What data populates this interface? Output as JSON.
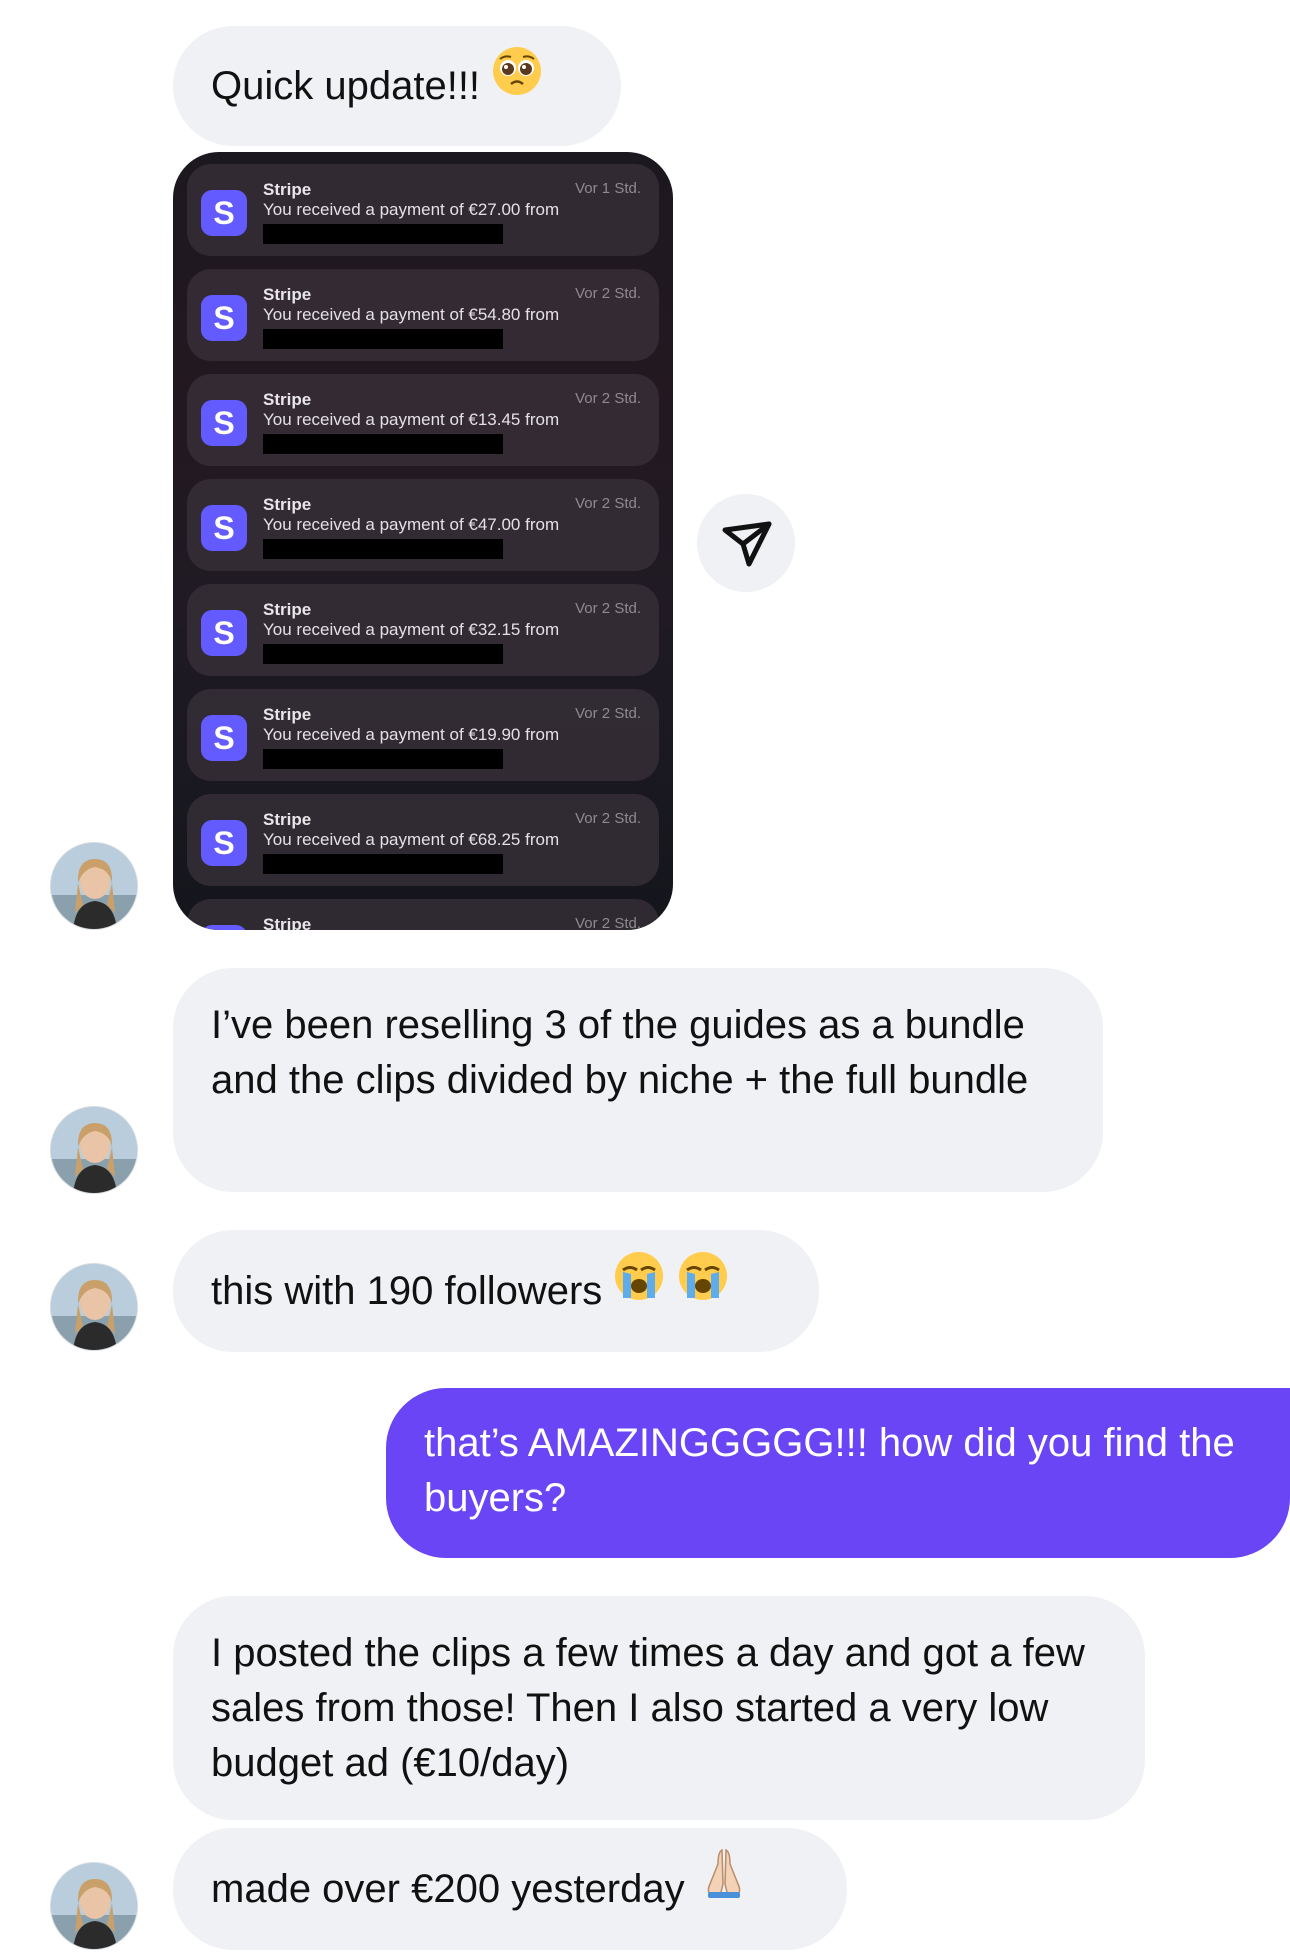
{
  "messages": {
    "m1": "Quick update!!!",
    "m2": "I’ve been reselling 3 of the guides as a bundle and the clips divided by niche + the full bundle",
    "m3": "this with 190 followers",
    "m4": "that’s AMAZINGGGGG!!! how did you find the buyers?",
    "m5": "I posted the clips a few times a day and got a few sales from those! Then I also started a very low budget ad (€10/day)",
    "m6": "made over €200 yesterday"
  },
  "screenshot": {
    "notifications": [
      {
        "app": "Stripe",
        "time": "Vor 1 Std.",
        "body": "You received a payment of €27.00 from"
      },
      {
        "app": "Stripe",
        "time": "Vor 2 Std.",
        "body": "You received a payment of €54.80 from"
      },
      {
        "app": "Stripe",
        "time": "Vor 2 Std.",
        "body": "You received a payment of €13.45 from"
      },
      {
        "app": "Stripe",
        "time": "Vor 2 Std.",
        "body": "You received a payment of €47.00 from"
      },
      {
        "app": "Stripe",
        "time": "Vor 2 Std.",
        "body": "You received a payment of €32.15 from"
      },
      {
        "app": "Stripe",
        "time": "Vor 2 Std.",
        "body": "You received a payment of €19.90 from"
      },
      {
        "app": "Stripe",
        "time": "Vor 2 Std.",
        "body": "You received a payment of €68.25 from"
      },
      {
        "app": "Stripe",
        "time": "Vor 2 Std.",
        "body": ""
      }
    ],
    "app_icon_letter": "S"
  },
  "colors": {
    "incoming_bubble": "#eff1f4",
    "outgoing_bubble": "#6a45f5",
    "stripe_brand": "#635bff"
  },
  "icons": {
    "share": "share-icon",
    "emoji_pleading": "pleading-face-emoji",
    "emoji_crying": "loudly-crying-face-emoji",
    "emoji_pray": "folded-hands-emoji"
  }
}
